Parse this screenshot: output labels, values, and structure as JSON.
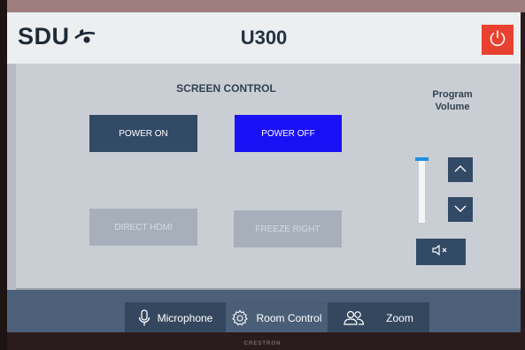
{
  "header": {
    "logo_text": "SDU",
    "room": "U300",
    "power_icon": "power-icon",
    "power_color": "#e8412f"
  },
  "screen_control": {
    "title": "SCREEN CONTROL",
    "buttons": [
      {
        "label": "POWER ON",
        "state": "normal"
      },
      {
        "label": "POWER OFF",
        "state": "active"
      },
      {
        "label": "DIRECT HDMI",
        "state": "disabled"
      },
      {
        "label": "FREEZE RIGHT",
        "state": "disabled"
      }
    ]
  },
  "volume": {
    "label_line1": "Program",
    "label_line2": "Volume",
    "level": 1.0,
    "up_icon": "chevron-up-icon",
    "down_icon": "chevron-down-icon",
    "mute_icon": "speaker-mute-icon"
  },
  "nav": {
    "items": [
      {
        "label": "Microphone",
        "icon": "microphone-icon"
      },
      {
        "label": "Room Control",
        "icon": "gear-icon"
      },
      {
        "label": "Zoom",
        "icon": "people-icon"
      }
    ]
  },
  "bezel_brand": "CRESTRON",
  "colors": {
    "accent_blue": "#1a10f5",
    "button_dark": "#334a66",
    "slider_handle": "#1e8fe0"
  }
}
